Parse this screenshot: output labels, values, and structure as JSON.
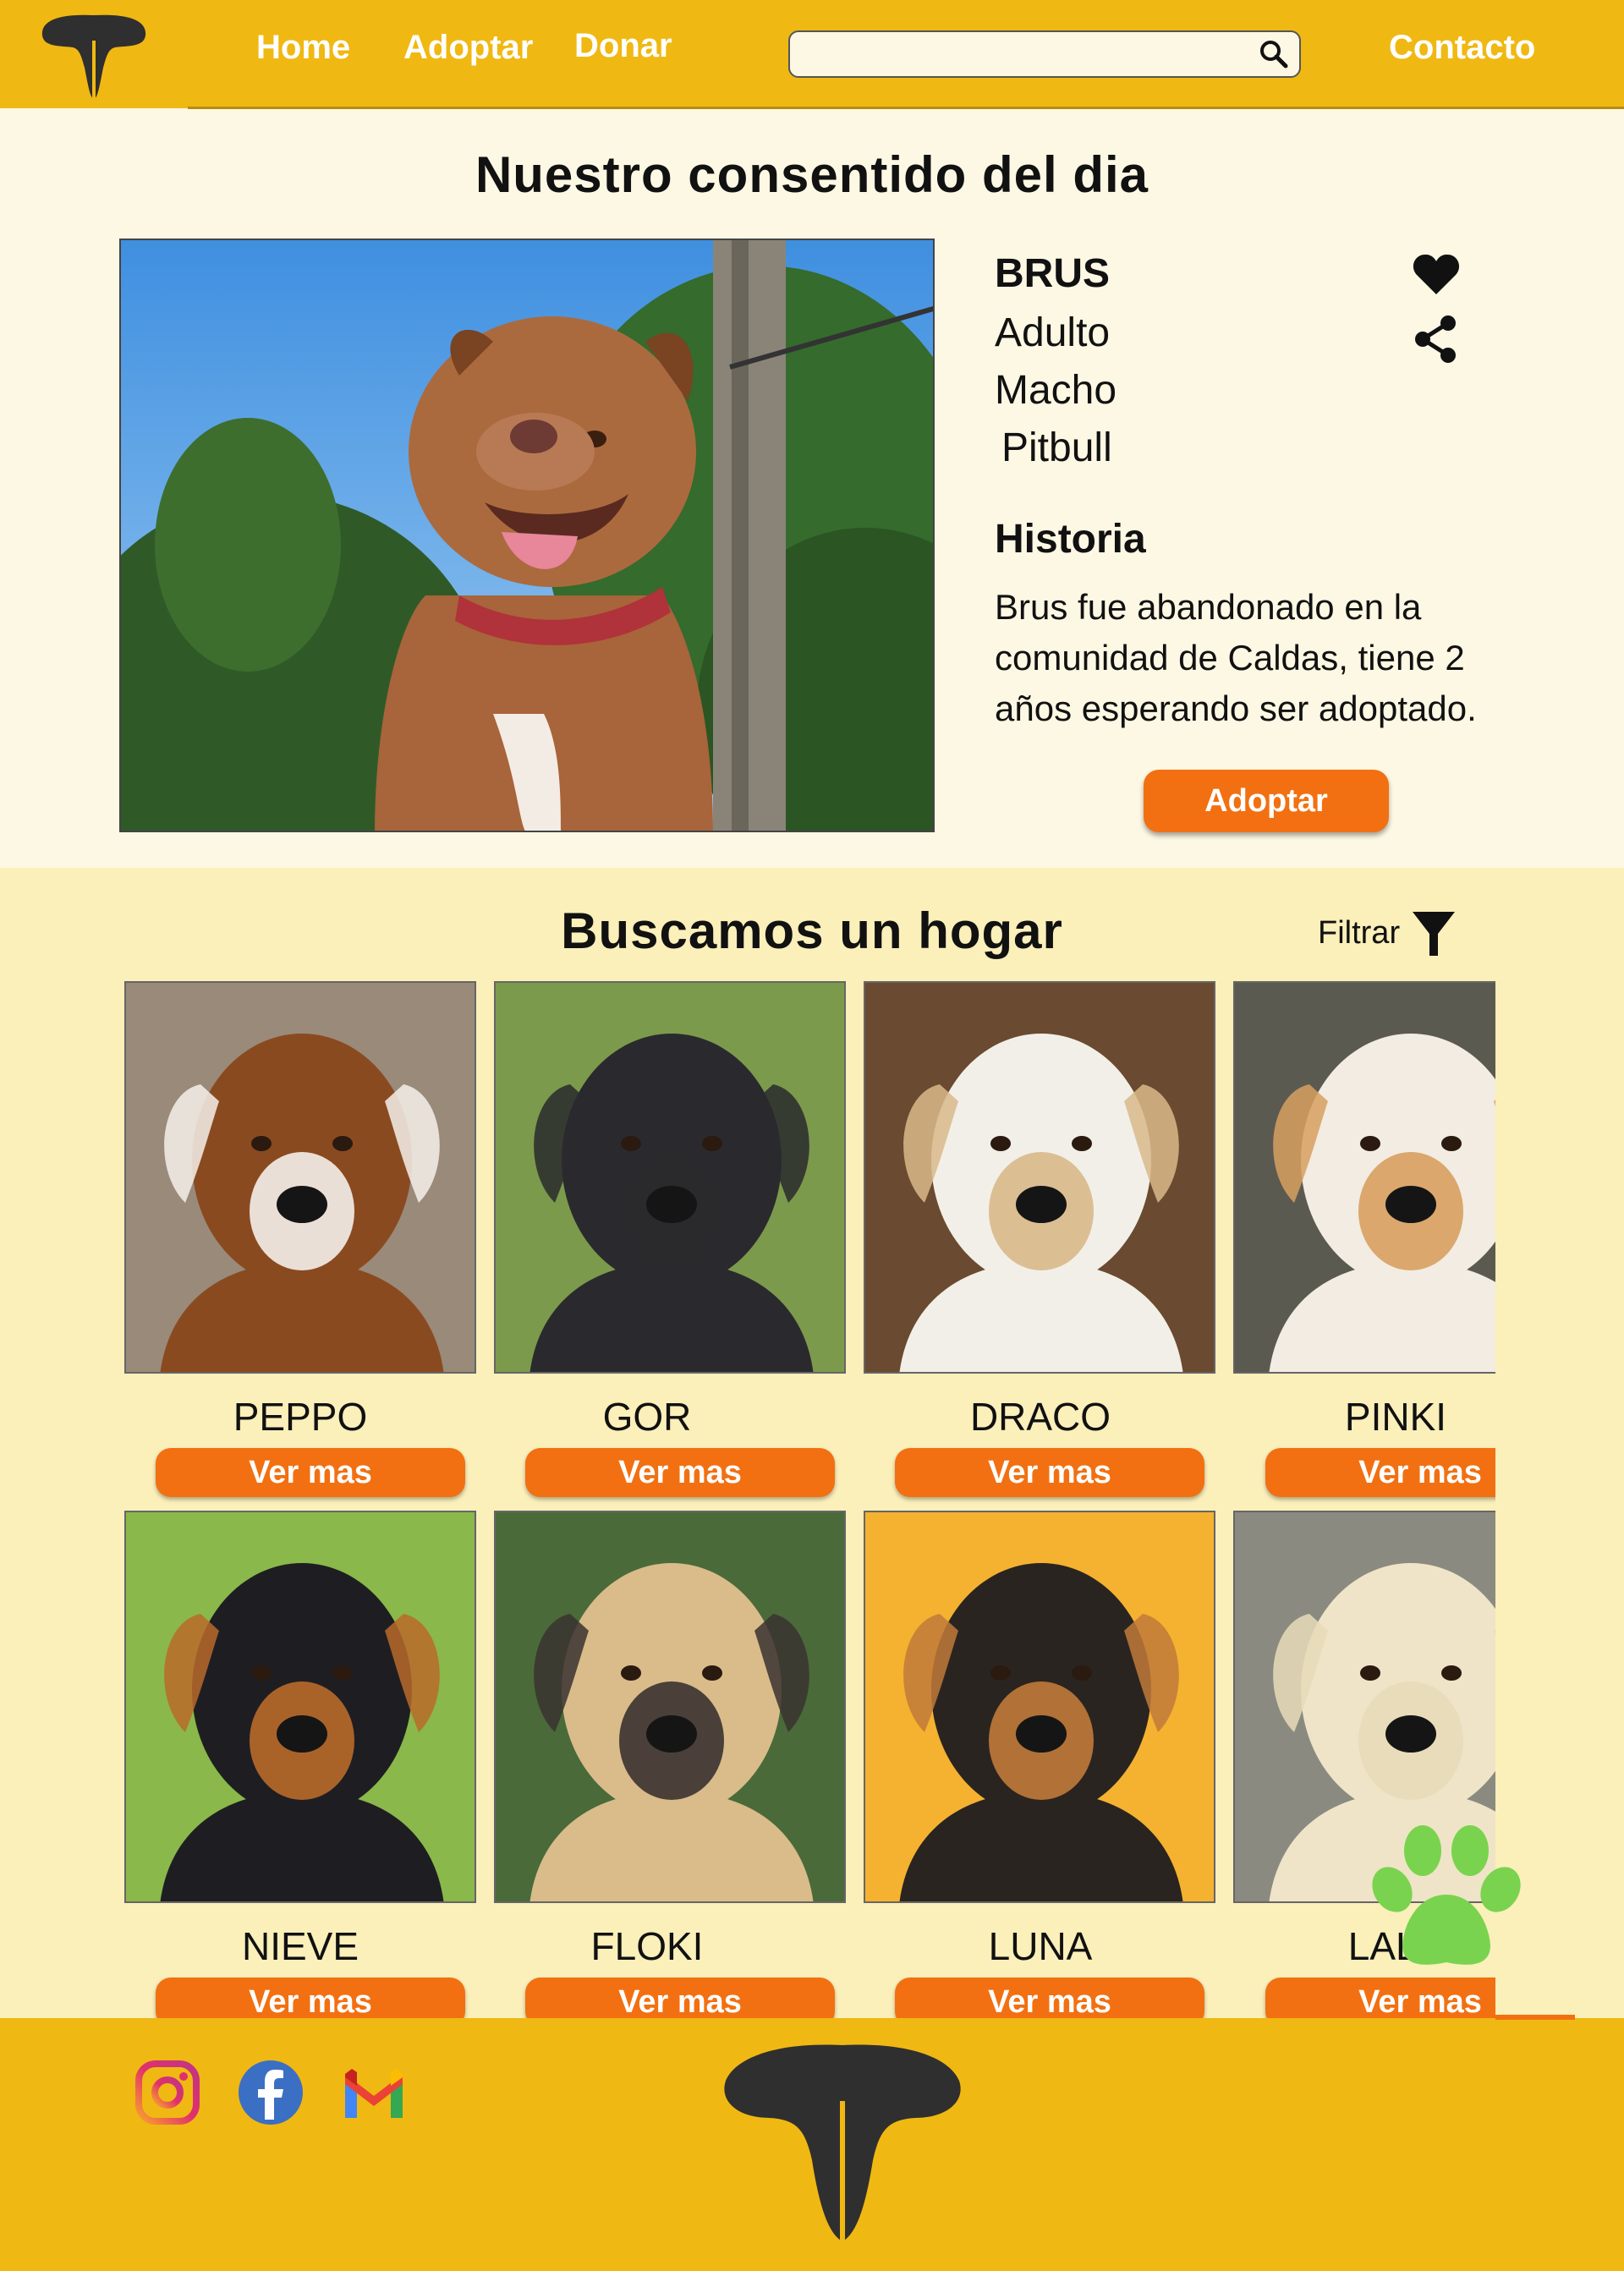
{
  "colors": {
    "brand_yellow": "#f0b812",
    "accent_orange": "#f27011",
    "cream": "#fdf8e4",
    "section_yellow": "#fbefba",
    "paw_green": "#7ad34e"
  },
  "header": {
    "logo_icon": "dog-nose-logo",
    "nav": {
      "home": "Home",
      "adopt": "Adoptar",
      "donate": "Donar",
      "contact": "Contacto"
    },
    "search": {
      "value": "",
      "placeholder": "",
      "icon": "search-icon"
    }
  },
  "featured": {
    "title": "Nuestro consentido del dia",
    "name": "BRUS",
    "age": "Adulto",
    "sex": "Macho",
    "breed": "Pitbull",
    "history_title": "Historia",
    "history_text": "Brus fue abandonado en la comunidad de Caldas, tiene 2 años esperando ser adoptado.",
    "adopt_label": "Adoptar",
    "icons": [
      "heart-icon",
      "share-icon"
    ]
  },
  "adoption": {
    "title": "Buscamos un hogar",
    "filter_label": "Filtrar",
    "button_label": "Ver mas",
    "dogs": [
      {
        "name": "PEPPO",
        "bg": "#9a8a7a",
        "coat": "#8a4a20",
        "face": "#f4f0ea"
      },
      {
        "name": "GOR",
        "bg": "#7c9a4c",
        "coat": "#2a2a2e",
        "face": "#2a2a2e"
      },
      {
        "name": "DRACO",
        "bg": "#6a4a30",
        "coat": "#f2efe8",
        "face": "#d9b88a"
      },
      {
        "name": "PINKI",
        "bg": "#5a5a50",
        "coat": "#f2ece2",
        "face": "#d8a060"
      },
      {
        "name": "NIEVE",
        "bg": "#8ab84a",
        "coat": "#1e1e22",
        "face": "#b86a2a"
      },
      {
        "name": "FLOKI",
        "bg": "#4a6a3a",
        "coat": "#d9bc8a",
        "face": "#3a3230"
      },
      {
        "name": "LUNA",
        "bg": "#f4b230",
        "coat": "#2a2420",
        "face": "#c07a3a"
      },
      {
        "name": "LALA",
        "bg": "#8a8a80",
        "coat": "#efe4c8",
        "face": "#e8dab8"
      }
    ]
  },
  "footer": {
    "social": [
      "instagram-icon",
      "facebook-icon",
      "gmail-icon"
    ],
    "logo_icon": "dog-nose-logo"
  }
}
